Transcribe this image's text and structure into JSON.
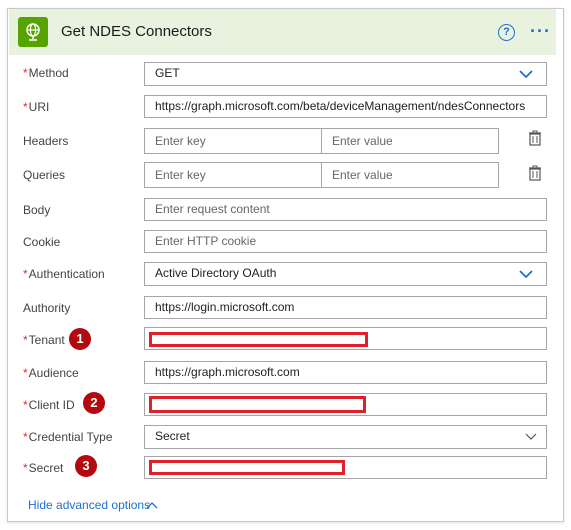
{
  "header": {
    "title": "Get NDES Connectors",
    "help_icon": "help-icon",
    "more_icon": "more-options-icon",
    "accent_color": "#57a300",
    "link_color": "#1f6fd1"
  },
  "fields": {
    "method": {
      "label": "Method",
      "required": "*",
      "value": "GET"
    },
    "uri": {
      "label": "URI",
      "required": "*",
      "value": "https://graph.microsoft.com/beta/deviceManagement/ndesConnectors"
    },
    "headers": {
      "label": "Headers",
      "key_placeholder": "Enter key",
      "value_placeholder": "Enter value"
    },
    "queries": {
      "label": "Queries",
      "key_placeholder": "Enter key",
      "value_placeholder": "Enter value"
    },
    "body": {
      "label": "Body",
      "placeholder": "Enter request content"
    },
    "cookie": {
      "label": "Cookie",
      "placeholder": "Enter HTTP cookie"
    },
    "authentication": {
      "label": "Authentication",
      "required": "*",
      "value": "Active Directory OAuth"
    },
    "authority": {
      "label": "Authority",
      "value": "https://login.microsoft.com"
    },
    "tenant": {
      "label": "Tenant",
      "required": "*",
      "badge": "1"
    },
    "audience": {
      "label": "Audience",
      "required": "*",
      "value": "https://graph.microsoft.com"
    },
    "client_id": {
      "label": "Client ID",
      "required": "*",
      "badge": "2"
    },
    "credential_type": {
      "label": "Credential Type",
      "required": "*",
      "value": "Secret"
    },
    "secret": {
      "label": "Secret",
      "required": "*",
      "badge": "3"
    }
  },
  "footer": {
    "advanced_link": "Hide advanced options"
  },
  "colors": {
    "required": "#d13438",
    "redaction": "#e0202a",
    "badge": "#b3080e",
    "header_bg": "#e8f2df"
  }
}
